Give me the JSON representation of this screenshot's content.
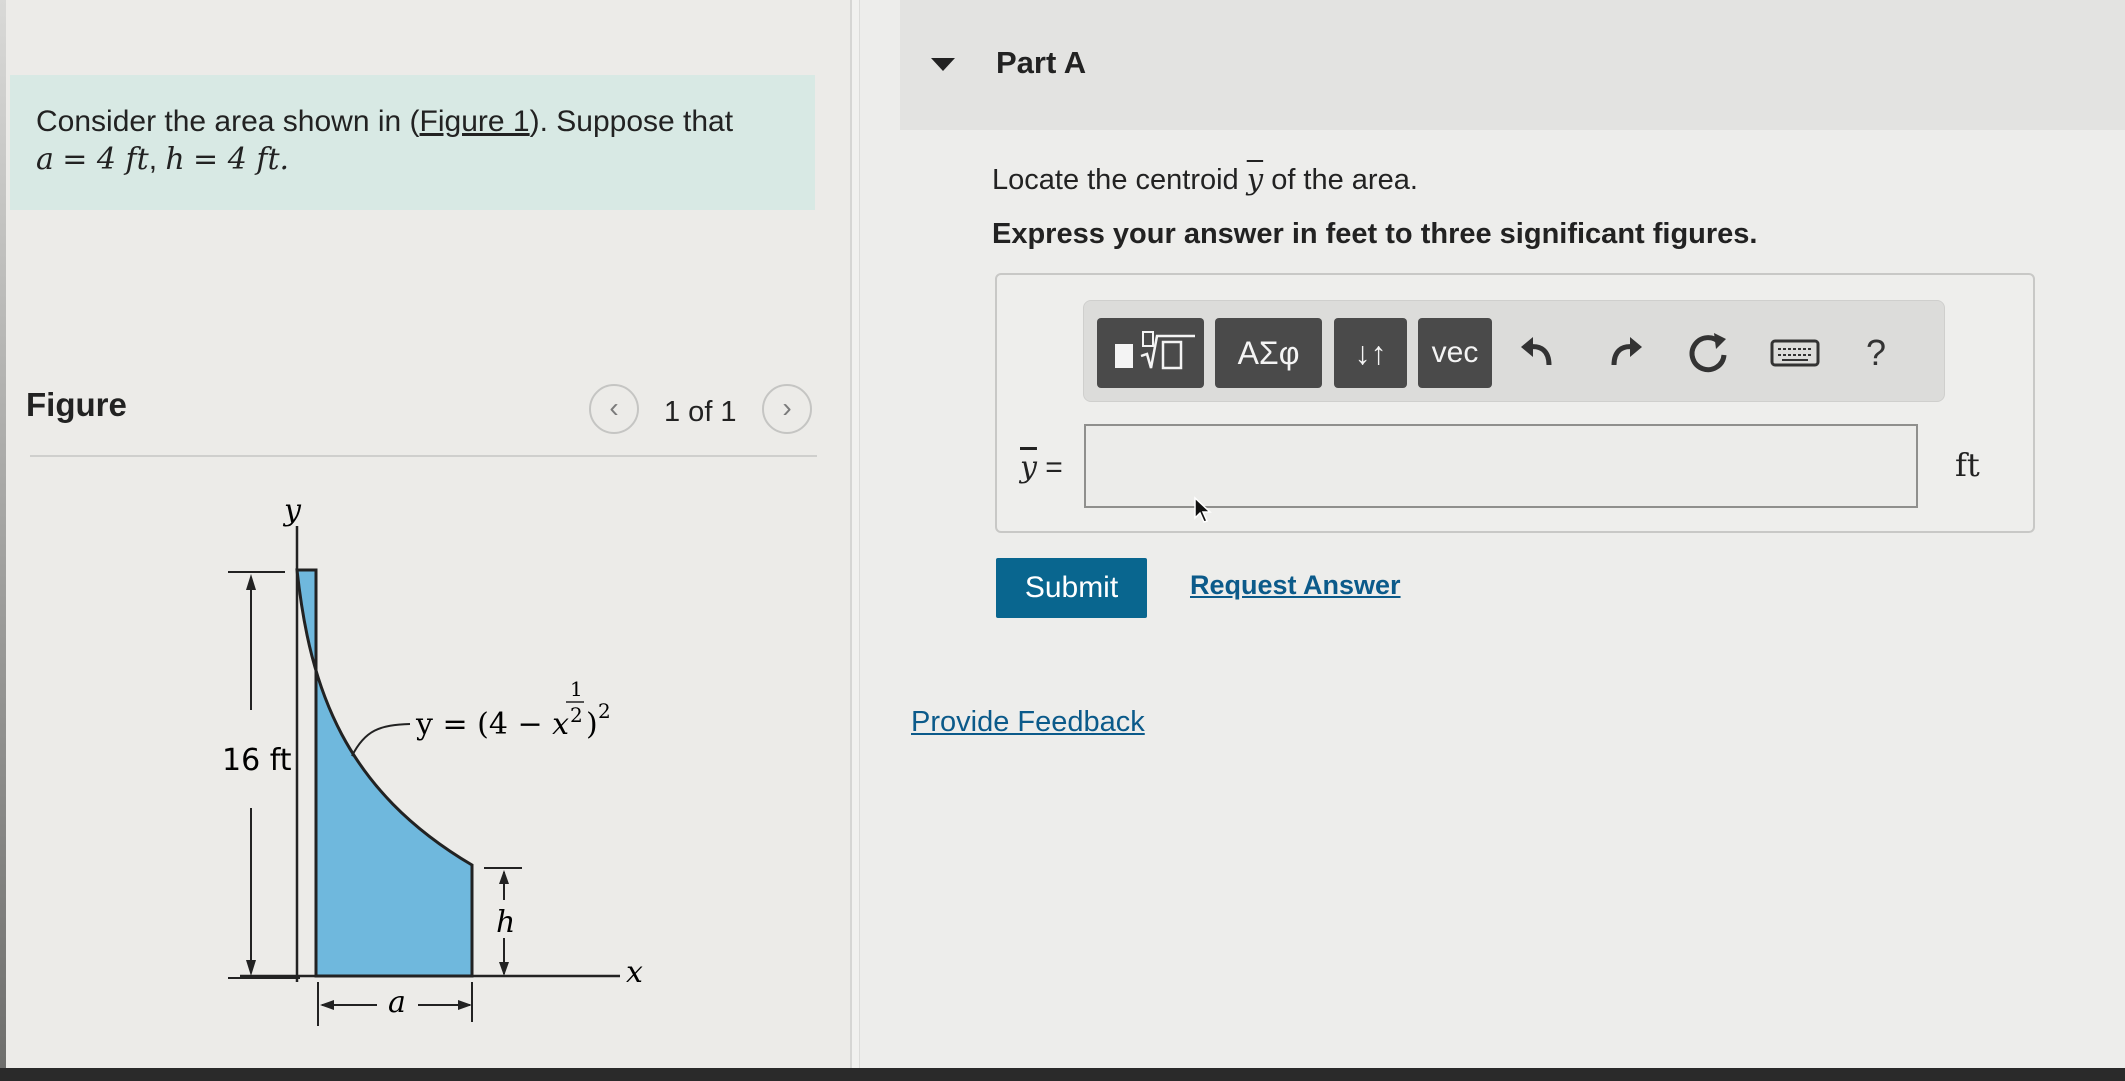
{
  "problem": {
    "intro": "Consider the area shown in (",
    "figure_link": "Figure 1",
    "intro_end": "). Suppose that",
    "given_a_var": "a",
    "given_a_value": "= 4 ft",
    "given_h_var": "h",
    "given_h_value": "= 4 ft."
  },
  "figure": {
    "title": "Figure",
    "page_label": "1 of 1",
    "prev_icon": "chevron-left-icon",
    "next_icon": "chevron-right-icon",
    "y_axis": "y",
    "x_axis": "x",
    "height_label": "16 ft",
    "h_label": "h",
    "a_label": "a",
    "eq_lhs": "y = (4 −",
    "eq_x": "x",
    "eq_exp_num": "1",
    "eq_exp_den": "2",
    "eq_outer_exp": "2",
    "eq_close": ")",
    "fill_color": "#6fb8dd"
  },
  "part": {
    "title": "Part A",
    "question_pre": "Locate the centroid",
    "question_var": "y",
    "question_post": "of the area.",
    "instruction": "Express your answer in feet to three significant figures.",
    "toolbar": {
      "templates_icon": "templates-icon",
      "greek_label": "ΑΣφ",
      "sort_label": "↓↑",
      "vec_label": "vec",
      "undo_icon": "undo-icon",
      "redo_icon": "redo-icon",
      "reset_icon": "reset-icon",
      "keyboard_icon": "keyboard-icon",
      "help_label": "?"
    },
    "answer_label_var": "y",
    "answer_label_eq": "=",
    "answer_value": "",
    "unit": "ft",
    "submit_label": "Submit",
    "request_label": "Request Answer"
  },
  "feedback_label": "Provide Feedback"
}
